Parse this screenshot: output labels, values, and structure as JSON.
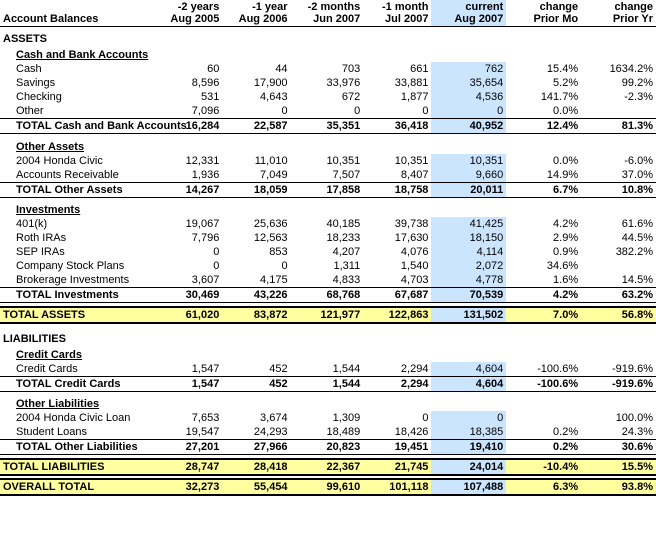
{
  "title": "Account Balances",
  "columns": {
    "header1": "-2 years",
    "header2": "-1 year",
    "header3": "-2 months",
    "header4": "-1 month",
    "header5": "current",
    "header6": "change",
    "header7": "change",
    "sub1": "Aug 2005",
    "sub2": "Aug 2006",
    "sub3": "Jun 2007",
    "sub4": "Jul 2007",
    "sub5": "Aug 2007",
    "sub6": "Prior Mo",
    "sub7": "Prior Yr"
  },
  "sections": {
    "assets_label": "ASSETS",
    "cash_section": "Cash and Bank Accounts",
    "cash_rows": [
      {
        "label": "Cash",
        "c1": "60",
        "c2": "44",
        "c3": "703",
        "c4": "661",
        "c5": "762",
        "c6": "15.4%",
        "c7": "1634.2%"
      },
      {
        "label": "Savings",
        "c1": "8,596",
        "c2": "17,900",
        "c3": "33,976",
        "c4": "33,881",
        "c5": "35,654",
        "c6": "5.2%",
        "c7": "99.2%"
      },
      {
        "label": "Checking",
        "c1": "531",
        "c2": "4,643",
        "c3": "672",
        "c4": "1,877",
        "c5": "4,536",
        "c6": "141.7%",
        "c7": "-2.3%"
      },
      {
        "label": "Other",
        "c1": "7,096",
        "c2": "0",
        "c3": "0",
        "c4": "0",
        "c5": "0",
        "c6": "0.0%",
        "c7": ""
      }
    ],
    "cash_total": {
      "label": "TOTAL Cash and Bank Accounts",
      "c1": "16,284",
      "c2": "22,587",
      "c3": "35,351",
      "c4": "36,418",
      "c5": "40,952",
      "c6": "12.4%",
      "c7": "81.3%"
    },
    "other_assets_section": "Other Assets",
    "other_assets_rows": [
      {
        "label": "2004 Honda Civic",
        "c1": "12,331",
        "c2": "11,010",
        "c3": "10,351",
        "c4": "10,351",
        "c5": "10,351",
        "c6": "0.0%",
        "c7": "-6.0%"
      },
      {
        "label": "Accounts Receivable",
        "c1": "1,936",
        "c2": "7,049",
        "c3": "7,507",
        "c4": "8,407",
        "c5": "9,660",
        "c6": "14.9%",
        "c7": "37.0%"
      }
    ],
    "other_assets_total": {
      "label": "TOTAL Other Assets",
      "c1": "14,267",
      "c2": "18,059",
      "c3": "17,858",
      "c4": "18,758",
      "c5": "20,011",
      "c6": "6.7%",
      "c7": "10.8%"
    },
    "investments_section": "Investments",
    "investments_rows": [
      {
        "label": "401(k)",
        "c1": "19,067",
        "c2": "25,636",
        "c3": "40,185",
        "c4": "39,738",
        "c5": "41,425",
        "c6": "4.2%",
        "c7": "61.6%"
      },
      {
        "label": "Roth IRAs",
        "c1": "7,796",
        "c2": "12,563",
        "c3": "18,233",
        "c4": "17,630",
        "c5": "18,150",
        "c6": "2.9%",
        "c7": "44.5%"
      },
      {
        "label": "SEP IRAs",
        "c1": "0",
        "c2": "853",
        "c3": "4,207",
        "c4": "4,076",
        "c5": "4,114",
        "c6": "0.9%",
        "c7": "382.2%"
      },
      {
        "label": "Company Stock Plans",
        "c1": "0",
        "c2": "0",
        "c3": "1,311",
        "c4": "1,540",
        "c5": "2,072",
        "c6": "34.6%",
        "c7": ""
      },
      {
        "label": "Brokerage Investments",
        "c1": "3,607",
        "c2": "4,175",
        "c3": "4,833",
        "c4": "4,703",
        "c5": "4,778",
        "c6": "1.6%",
        "c7": "14.5%"
      }
    ],
    "investments_total": {
      "label": "TOTAL Investments",
      "c1": "30,469",
      "c2": "43,226",
      "c3": "68,768",
      "c4": "67,687",
      "c5": "70,539",
      "c6": "4.2%",
      "c7": "63.2%"
    },
    "total_assets": {
      "label": "TOTAL ASSETS",
      "c1": "61,020",
      "c2": "83,872",
      "c3": "121,977",
      "c4": "122,863",
      "c5": "131,502",
      "c6": "7.0%",
      "c7": "56.8%"
    },
    "liabilities_label": "LIABILITIES",
    "credit_section": "Credit Cards",
    "credit_rows": [
      {
        "label": "Credit Cards",
        "c1": "1,547",
        "c2": "452",
        "c3": "1,544",
        "c4": "2,294",
        "c5": "4,604",
        "c6": "-100.6%",
        "c7": "-919.6%"
      }
    ],
    "credit_total": {
      "label": "TOTAL Credit Cards",
      "c1": "1,547",
      "c2": "452",
      "c3": "1,544",
      "c4": "2,294",
      "c5": "4,604",
      "c6": "-100.6%",
      "c7": "-919.6%"
    },
    "other_liabilities_section": "Other Liabilities",
    "other_liabilities_rows": [
      {
        "label": "2004 Honda Civic Loan",
        "c1": "7,653",
        "c2": "3,674",
        "c3": "1,309",
        "c4": "0",
        "c5": "0",
        "c6": "",
        "c7": "100.0%"
      },
      {
        "label": "Student Loans",
        "c1": "19,547",
        "c2": "24,293",
        "c3": "18,489",
        "c4": "18,426",
        "c5": "18,385",
        "c6": "0.2%",
        "c7": "24.3%"
      }
    ],
    "other_liabilities_total": {
      "label": "TOTAL Other Liabilities",
      "c1": "27,201",
      "c2": "27,966",
      "c3": "20,823",
      "c4": "19,451",
      "c5": "19,410",
      "c6": "0.2%",
      "c7": "30.6%"
    },
    "total_liabilities": {
      "label": "TOTAL LIABILITIES",
      "c1": "28,747",
      "c2": "28,418",
      "c3": "22,367",
      "c4": "21,745",
      "c5": "24,014",
      "c6": "-10.4%",
      "c7": "15.5%"
    },
    "overall_total": {
      "label": "OVERALL TOTAL",
      "c1": "32,273",
      "c2": "55,454",
      "c3": "99,610",
      "c4": "101,118",
      "c5": "107,488",
      "c6": "6.3%",
      "c7": "93.8%"
    }
  }
}
